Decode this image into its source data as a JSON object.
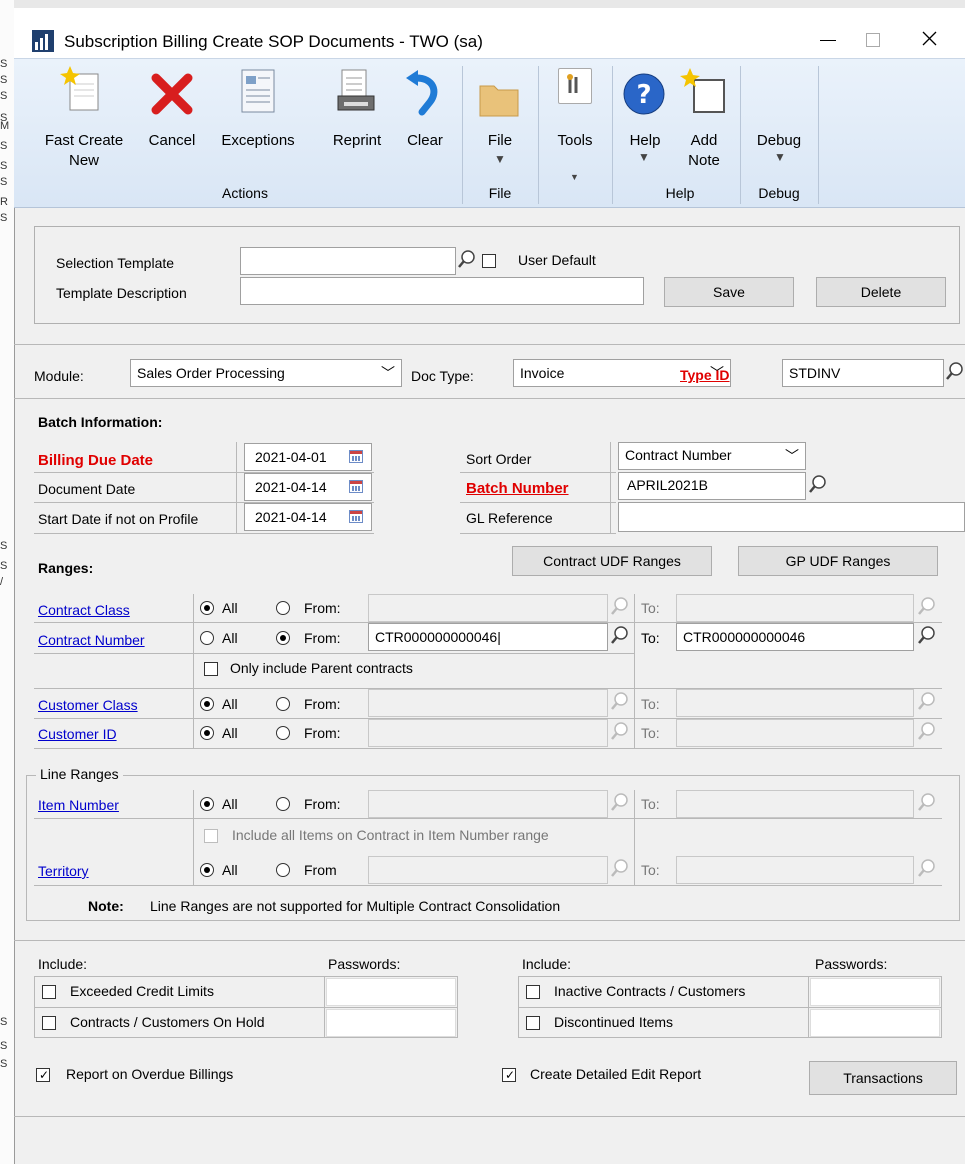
{
  "window": {
    "title": "Subscription Billing Create SOP Documents  -  TWO (sa)"
  },
  "ribbon": {
    "buttons": {
      "fast_create_line1": "Fast Create",
      "fast_create_line2": "New",
      "cancel": "Cancel",
      "exceptions": "Exceptions",
      "reprint": "Reprint",
      "clear": "Clear",
      "file": "File",
      "tools": "Tools",
      "help": "Help",
      "add_note_line1": "Add",
      "add_note_line2": "Note",
      "debug": "Debug"
    },
    "groups": {
      "actions": "Actions",
      "file": "File",
      "help": "Help",
      "debug": "Debug"
    }
  },
  "template": {
    "selection_template_label": "Selection Template",
    "selection_template_value": "",
    "user_default_label": "User Default",
    "template_description_label": "Template Description",
    "template_description_value": "",
    "save_label": "Save",
    "delete_label": "Delete"
  },
  "module_row": {
    "module_label": "Module:",
    "module_value": "Sales Order Processing",
    "doc_type_label": "Doc Type:",
    "doc_type_value": "Invoice",
    "type_id_label": "Type ID",
    "type_id_value": "STDINV"
  },
  "batch": {
    "header": "Batch Information:",
    "billing_due_date_label": "Billing Due Date",
    "billing_due_date": "2021-04-01",
    "document_date_label": "Document Date",
    "document_date": "2021-04-14",
    "start_date_label": "Start Date if not on Profile",
    "start_date": "2021-04-14",
    "sort_order_label": "Sort Order",
    "sort_order_value": "Contract Number",
    "batch_number_label": "Batch Number",
    "batch_number_value": "APRIL2021B",
    "gl_reference_label": "GL Reference",
    "gl_reference_value": ""
  },
  "ranges": {
    "header": "Ranges:",
    "contract_udf_label": "Contract UDF Ranges",
    "gp_udf_label": "GP UDF Ranges",
    "all_label": "All",
    "from_label": "From:",
    "from_label_plain": "From",
    "to_label": "To:",
    "contract_class_label": "Contract Class",
    "contract_number_label": "Contract Number",
    "contract_from_value": "CTR000000000046|",
    "contract_to_value": "CTR000000000046",
    "parent_only_label": "Only include Parent contracts",
    "customer_class_label": "Customer Class",
    "customer_id_label": "Customer ID",
    "line_ranges_label": "Line Ranges",
    "item_number_label": "Item Number",
    "include_all_items_label": "Include all Items on Contract in Item Number range",
    "territory_label": "Territory",
    "note_bold": "Note:",
    "note_text": "Line Ranges are not supported for Multiple Contract Consolidation"
  },
  "include": {
    "include_label": "Include:",
    "passwords_label": "Passwords:",
    "exceeded_credit": "Exceeded Credit Limits",
    "on_hold": "Contracts / Customers On Hold",
    "inactive": "Inactive Contracts / Customers",
    "discontinued": "Discontinued Items",
    "report_overdue": "Report on Overdue Billings",
    "create_detailed": "Create Detailed Edit Report",
    "transactions": "Transactions"
  }
}
